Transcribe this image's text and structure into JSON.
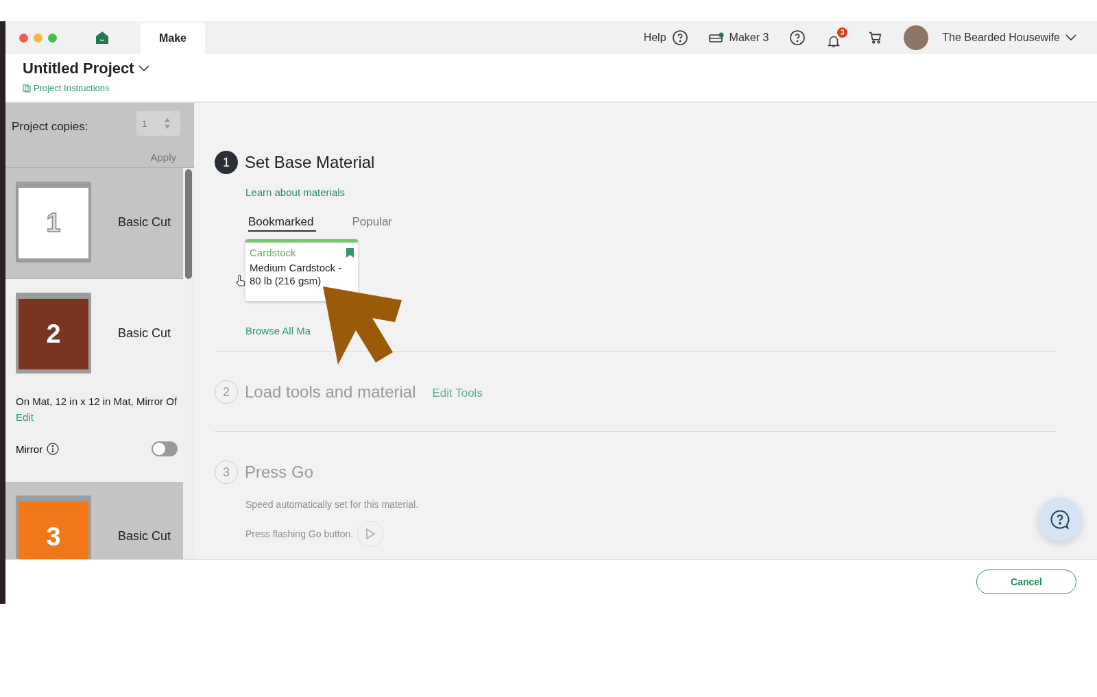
{
  "window": {
    "tab": "Make"
  },
  "top_bar": {
    "help": "Help",
    "machine": {
      "name": "Maker 3",
      "connected": true
    },
    "notifications": "3",
    "user": "The Bearded Housewife"
  },
  "project": {
    "title": "Untitled Project",
    "instructions": "Project Instructions"
  },
  "copies": {
    "label": "Project copies:",
    "value": "1",
    "apply": "Apply",
    "disabled": true
  },
  "mats": [
    {
      "number": "1",
      "color": "#ffffff",
      "mode": "Basic Cut",
      "selected": false
    },
    {
      "number": "2",
      "color": "#7a3520",
      "mode": "Basic Cut",
      "selected": true,
      "details": "On Mat, 12 in x 12 in Mat, Mirror Of",
      "edit": "Edit",
      "mirror_label": "Mirror",
      "mirror": false
    },
    {
      "number": "3",
      "color": "#f07818",
      "mode": "Basic Cut",
      "selected": false
    }
  ],
  "steps": [
    {
      "number": "1",
      "title": "Set Base Material",
      "active": true,
      "link": "Learn about materials",
      "tabs": [
        {
          "label": "Bookmarked",
          "selected": true
        },
        {
          "label": "Popular",
          "selected": false
        }
      ],
      "material": {
        "category": "Cardstock",
        "name": "Medium Cardstock - 80 lb (216 gsm)",
        "bookmarked": true
      },
      "browse": "Browse All Ma"
    },
    {
      "number": "2",
      "title": "Load tools and material",
      "active": false,
      "action": "Edit Tools"
    },
    {
      "number": "3",
      "title": "Press Go",
      "active": false,
      "lines": [
        "Speed automatically set for this material.",
        "Press flashing Go button."
      ]
    }
  ],
  "footer": {
    "cancel": "Cancel"
  }
}
